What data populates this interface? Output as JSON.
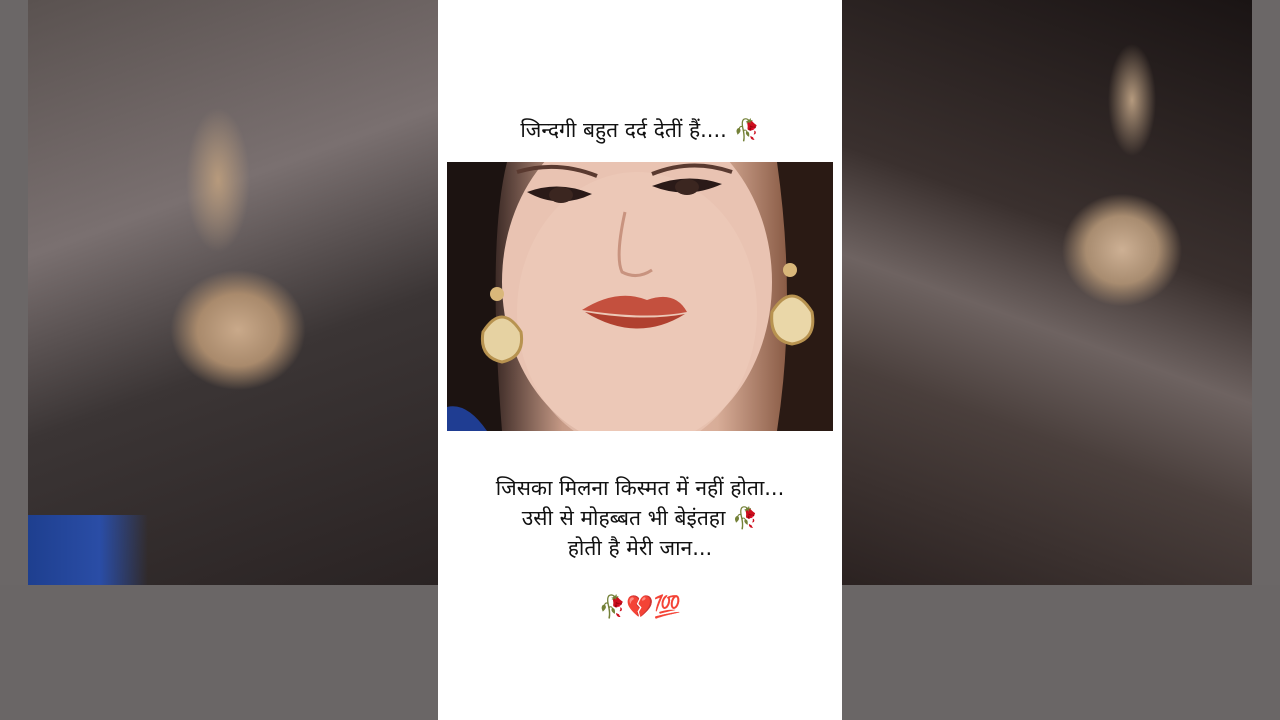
{
  "post": {
    "title": "जिन्दगी बहुत दर्द देतीं हैं.... 🥀",
    "quote_lines": [
      "जिसका मिलना किस्मत में नहीं होता...",
      "उसी से मोहब्बत भी बेइंतहा 🥀",
      "होती है मेरी जान..."
    ],
    "emoji_footer": "🥀💔💯"
  },
  "photo": {
    "subject": "woman with jhumka earrings looking down"
  },
  "colors": {
    "card_background": "#ffffff",
    "text": "#111111"
  }
}
